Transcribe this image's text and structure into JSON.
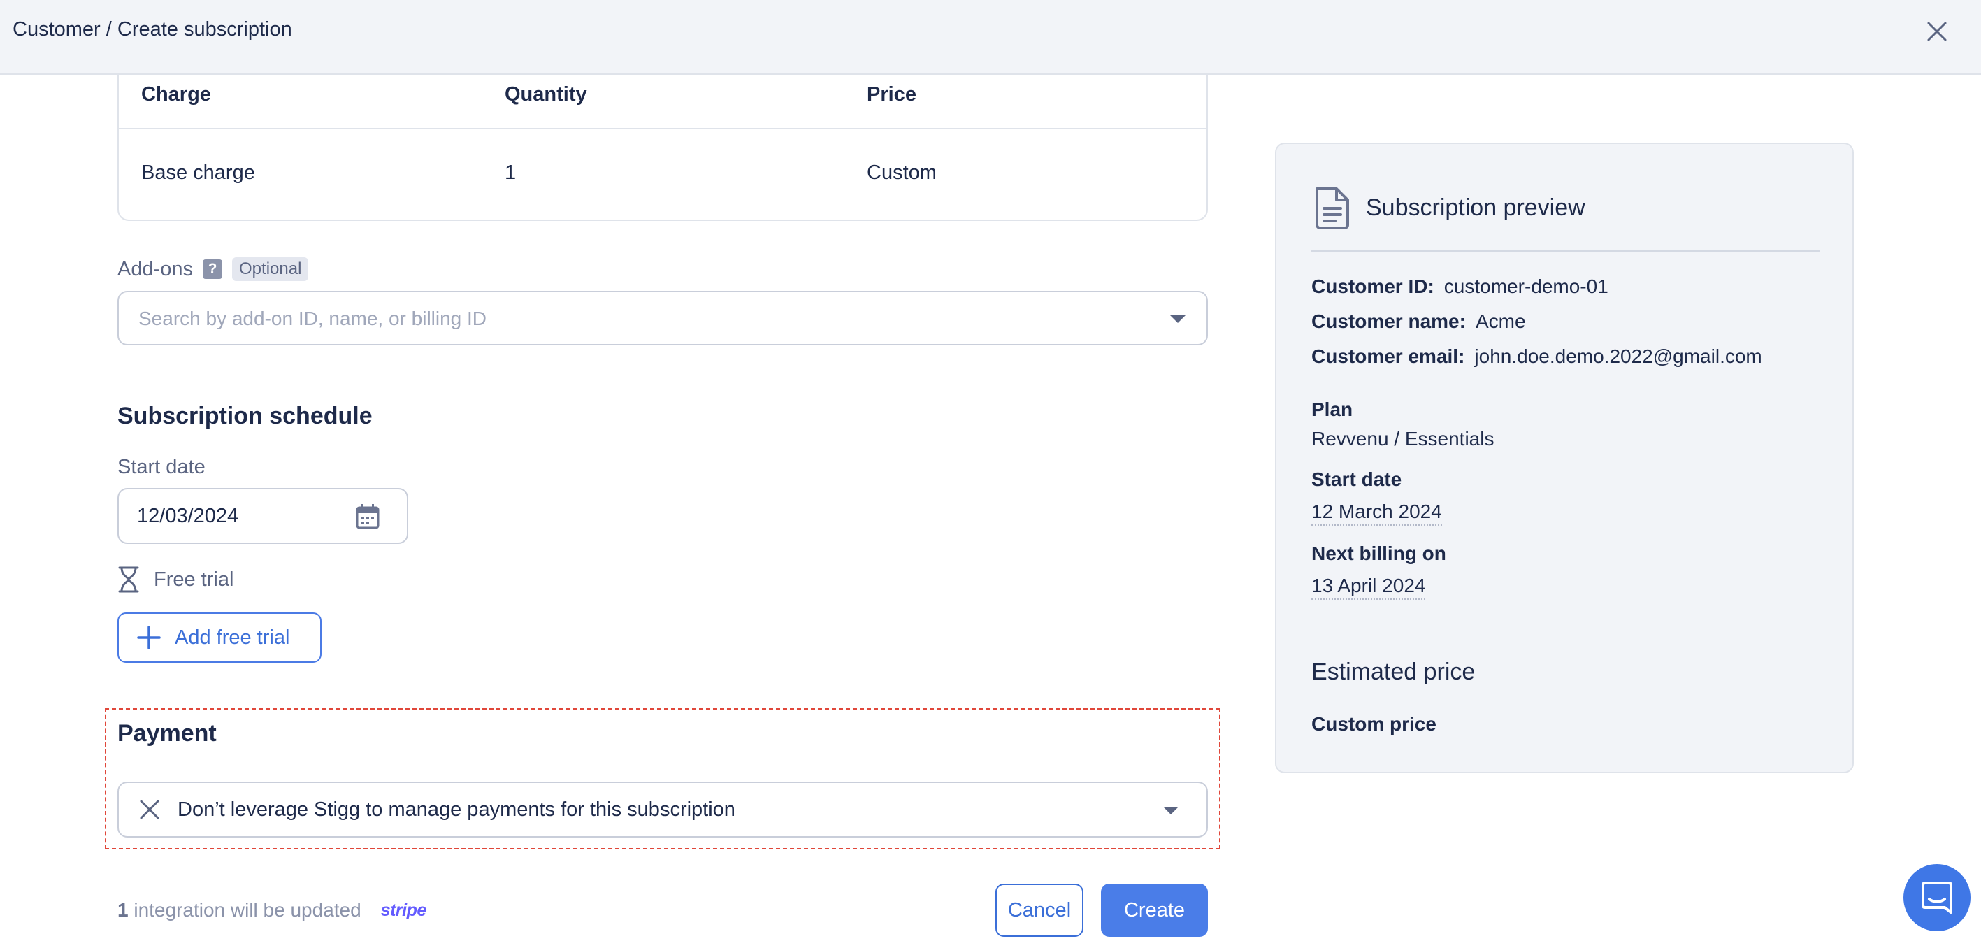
{
  "header": {
    "breadcrumb": "Customer / Create subscription"
  },
  "charges_table": {
    "columns": [
      "Charge",
      "Quantity",
      "Price"
    ],
    "rows": [
      {
        "charge": "Base charge",
        "quantity": "1",
        "price": "Custom"
      }
    ]
  },
  "addons": {
    "label": "Add-ons",
    "help": "?",
    "badge": "Optional",
    "placeholder": "Search by add-on ID, name, or billing ID"
  },
  "schedule": {
    "title": "Subscription schedule",
    "start_date_label": "Start date",
    "start_date_value": "12/03/2024",
    "free_trial_label": "Free trial",
    "add_free_trial_label": "Add free trial"
  },
  "payment": {
    "title": "Payment",
    "value": "Don’t leverage Stigg to manage payments for this subscription"
  },
  "footer": {
    "integration_count": "1",
    "integration_text": "integration will be updated",
    "integration_logo": "stripe",
    "cancel_label": "Cancel",
    "create_label": "Create"
  },
  "preview": {
    "title": "Subscription preview",
    "customer_id_label": "Customer ID:",
    "customer_id": "customer-demo-01",
    "customer_name_label": "Customer name:",
    "customer_name": "Acme",
    "customer_email_label": "Customer email:",
    "customer_email": "john.doe.demo.2022@gmail.com",
    "plan_label": "Plan",
    "plan_value": "Revvenu / Essentials",
    "start_date_label": "Start date",
    "start_date_value": "12 March 2024",
    "next_billing_label": "Next billing on",
    "next_billing_value": "13 April 2024",
    "estimated_title": "Estimated price",
    "estimated_value": "Custom price"
  },
  "colors": {
    "accent": "#4a7de8",
    "text": "#1e2a4a",
    "muted": "#5a6481",
    "border": "#c9ceda",
    "panel_bg": "#f2f4f8",
    "highlight_dashed": "#e0473a",
    "stripe": "#635bff"
  },
  "icons": [
    "close-icon",
    "help-icon",
    "chevron-down-icon",
    "calendar-icon",
    "hourglass-icon",
    "plus-icon",
    "clear-icon",
    "document-icon",
    "chat-icon"
  ]
}
